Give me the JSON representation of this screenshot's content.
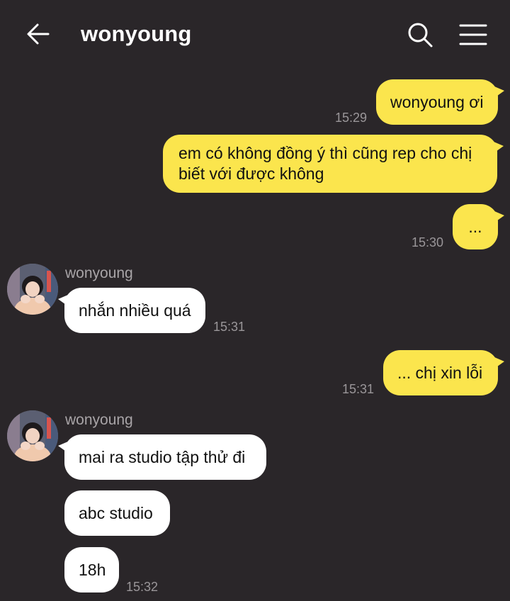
{
  "header": {
    "title": "wonyoung",
    "back_icon": "arrow-left-icon",
    "search_icon": "search-icon",
    "menu_icon": "hamburger-menu-icon"
  },
  "colors": {
    "background": "#2a2629",
    "outgoing_bubble": "#fbe54d",
    "incoming_bubble": "#ffffff",
    "timestamp": "#9a9699"
  },
  "messages": {
    "m1": {
      "text": "wonyoung ơi",
      "time": "15:29"
    },
    "m2": {
      "text": "em có không đồng ý thì cũng rep cho chị biết với được không"
    },
    "m3": {
      "text": "...",
      "time": "15:30"
    },
    "g1": {
      "sender": "wonyoung",
      "text": "nhắn nhiều quá",
      "time": "15:31"
    },
    "m4": {
      "text": "... chị xin lỗi",
      "time": "15:31"
    },
    "g2": {
      "sender": "wonyoung",
      "text1": "mai ra studio tập thử đi",
      "text2": "abc studio",
      "text3": "18h",
      "time": "15:32"
    }
  }
}
